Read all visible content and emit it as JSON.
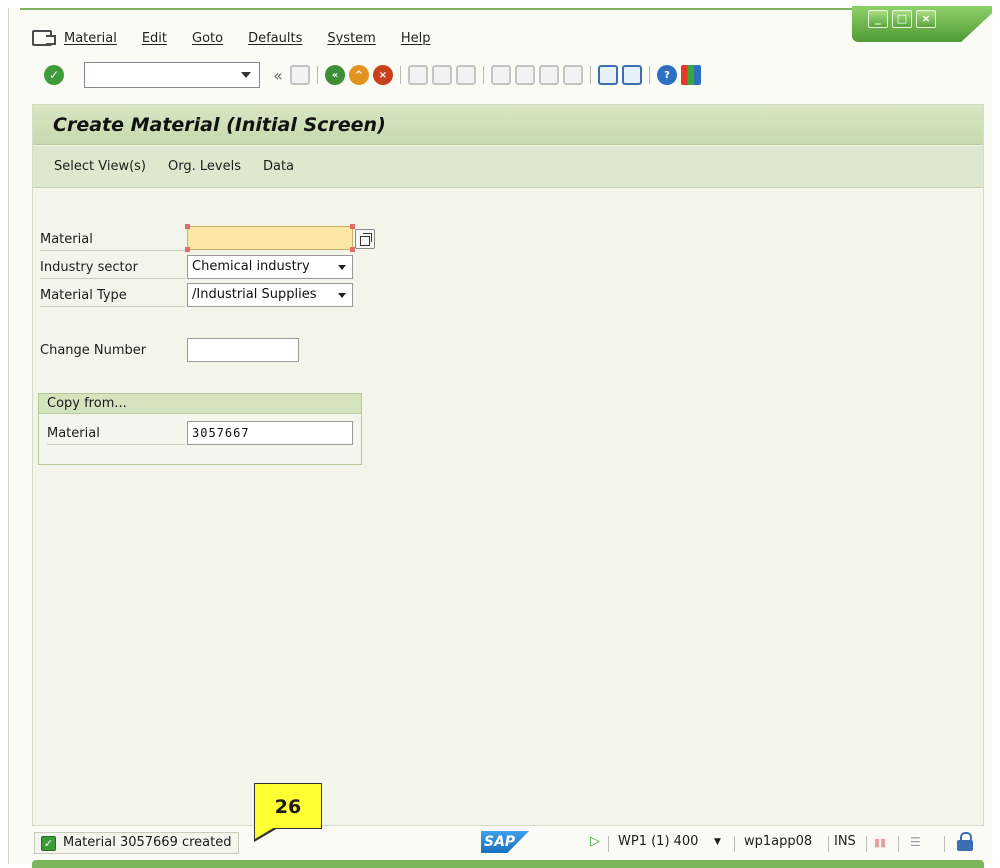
{
  "window": {
    "minimize": "_",
    "maximize": "□",
    "close": "×"
  },
  "menubar": {
    "items": [
      "Material",
      "Edit",
      "Goto",
      "Defaults",
      "System",
      "Help"
    ]
  },
  "toolbar": {
    "command_field": "",
    "icons": [
      "enter-icon",
      "save-icon",
      "back-icon",
      "exit-icon",
      "cancel-icon",
      "print-icon",
      "find-icon",
      "find-next-icon",
      "first-page-icon",
      "previous-page-icon",
      "next-page-icon",
      "last-page-icon",
      "create-session-icon",
      "shortcut-icon",
      "help-icon",
      "customize-layout-icon"
    ]
  },
  "screen": {
    "title": "Create Material (Initial Screen)",
    "app_buttons": [
      "Select View(s)",
      "Org. Levels",
      "Data"
    ]
  },
  "form": {
    "material_label": "Material",
    "material_value": "",
    "industry_sector_label": "Industry sector",
    "industry_sector_value": "Chemical industry",
    "material_type_label": "Material Type",
    "material_type_value": "/Industrial Supplies",
    "change_number_label": "Change Number",
    "change_number_value": ""
  },
  "copy_from": {
    "title": "Copy from...",
    "material_label": "Material",
    "material_value": "3057667"
  },
  "status": {
    "message": "Material 3057669 created",
    "sap_logo": "SAP",
    "system": "WP1 (1) 400",
    "server": "wp1app08",
    "mode": "INS"
  },
  "callout": {
    "number": "26"
  },
  "colors": {
    "title_bar": "#d8e6c4",
    "required_field": "#fce8a3",
    "success": "#3d9b35",
    "callout": "#ffff33"
  }
}
